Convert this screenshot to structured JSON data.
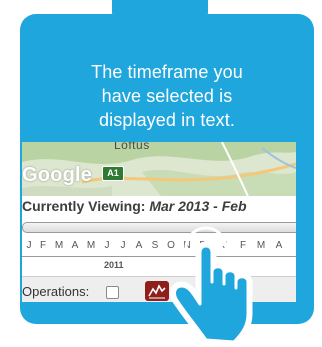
{
  "callout": {
    "message_lines": [
      "The timeframe you",
      "have selected is",
      "displayed in text."
    ],
    "background_color": "#1fa6dc",
    "text_color": "#ffffff"
  },
  "map": {
    "place_label": "Loftus",
    "provider_logo": "Google",
    "road_shield": "A1"
  },
  "timeline": {
    "viewing_label": "Currently Viewing:",
    "viewing_range": "Mar 2013 - Feb",
    "months": [
      "J",
      "F",
      "M",
      "A",
      "M",
      "J",
      "J",
      "A",
      "S",
      "O",
      "N",
      "D",
      "J",
      "F",
      "M",
      "A"
    ],
    "year_label": "2011"
  },
  "operations": {
    "label": "Operations:",
    "chart_button_color": "#8f1f1a"
  },
  "overlay": {
    "icon": "pointing-hand-icon"
  }
}
